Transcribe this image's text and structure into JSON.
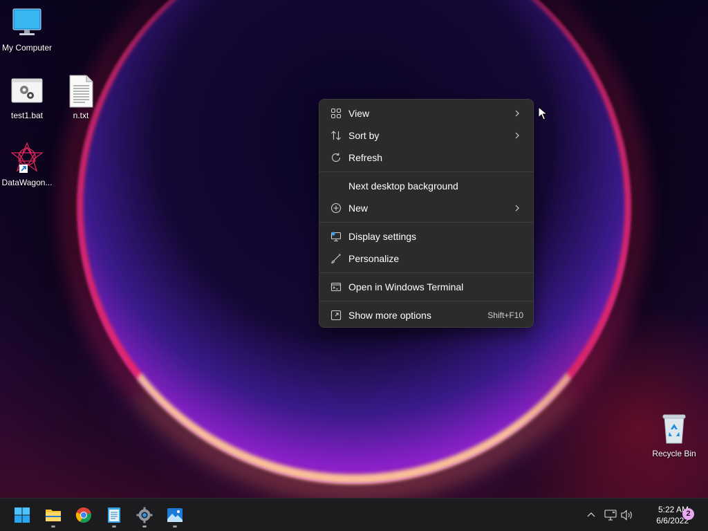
{
  "desktop": {
    "icons": [
      {
        "label": "My Computer",
        "icon": "monitor-icon"
      },
      {
        "label": "test1.bat",
        "icon": "batch-file-icon"
      },
      {
        "label": "n.txt",
        "icon": "text-file-icon"
      },
      {
        "label": "DataWagon...",
        "icon": "app-shortcut-icon"
      },
      {
        "label": "Recycle Bin",
        "icon": "recycle-bin-icon"
      }
    ]
  },
  "context_menu": {
    "items": [
      {
        "label": "View",
        "icon": "grid-view-icon",
        "submenu": true
      },
      {
        "label": "Sort by",
        "icon": "sort-icon",
        "submenu": true
      },
      {
        "label": "Refresh",
        "icon": "refresh-icon",
        "submenu": false
      },
      {
        "label": "Next desktop background",
        "icon": "",
        "submenu": false
      },
      {
        "label": "New",
        "icon": "plus-circle-icon",
        "submenu": true
      },
      {
        "label": "Display settings",
        "icon": "display-settings-icon",
        "submenu": false
      },
      {
        "label": "Personalize",
        "icon": "brush-icon",
        "submenu": false
      },
      {
        "label": "Open in Windows Terminal",
        "icon": "terminal-icon",
        "submenu": false
      },
      {
        "label": "Show more options",
        "icon": "more-options-icon",
        "shortcut": "Shift+F10"
      }
    ]
  },
  "taskbar": {
    "apps": [
      {
        "name": "Start",
        "icon": "windows-start-icon",
        "running": false
      },
      {
        "name": "File Explorer",
        "icon": "folder-icon",
        "running": true
      },
      {
        "name": "Chrome",
        "icon": "chrome-icon",
        "running": false
      },
      {
        "name": "Notepad",
        "icon": "notepad-icon",
        "running": true
      },
      {
        "name": "Settings",
        "icon": "settings-gear-icon",
        "running": true
      },
      {
        "name": "Photos",
        "icon": "photos-icon",
        "running": true
      }
    ],
    "tray": {
      "time": "5:22 AM",
      "date": "6/6/2022",
      "notification_count": "2"
    }
  },
  "colors": {
    "menu_bg": "#2b2b2b",
    "taskbar_bg": "#1c1c1f",
    "accent": "#0078d4"
  }
}
